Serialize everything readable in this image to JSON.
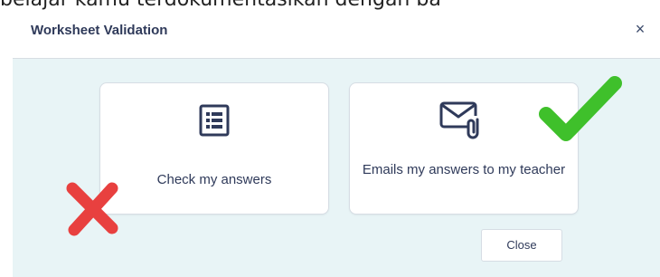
{
  "background": {
    "partial_text": "belajar kamu terdokumentasikan dengan ba"
  },
  "dialog": {
    "title": "Worksheet Validation",
    "close_symbol": "×",
    "options": [
      {
        "label": "Check my answers",
        "icon": "list-icon"
      },
      {
        "label": "Emails my answers to my teacher",
        "icon": "mail-attachment-icon"
      }
    ],
    "close_button_label": "Close"
  },
  "annotations": {
    "cross_mark": {
      "icon": "red-x-icon",
      "color": "#e8403f"
    },
    "check_mark": {
      "icon": "green-check-icon",
      "color": "#3fc02b"
    }
  },
  "colors": {
    "accent": "#2f3a5a",
    "body_background": "#e8f4f6",
    "card_border": "#d6dde4"
  }
}
